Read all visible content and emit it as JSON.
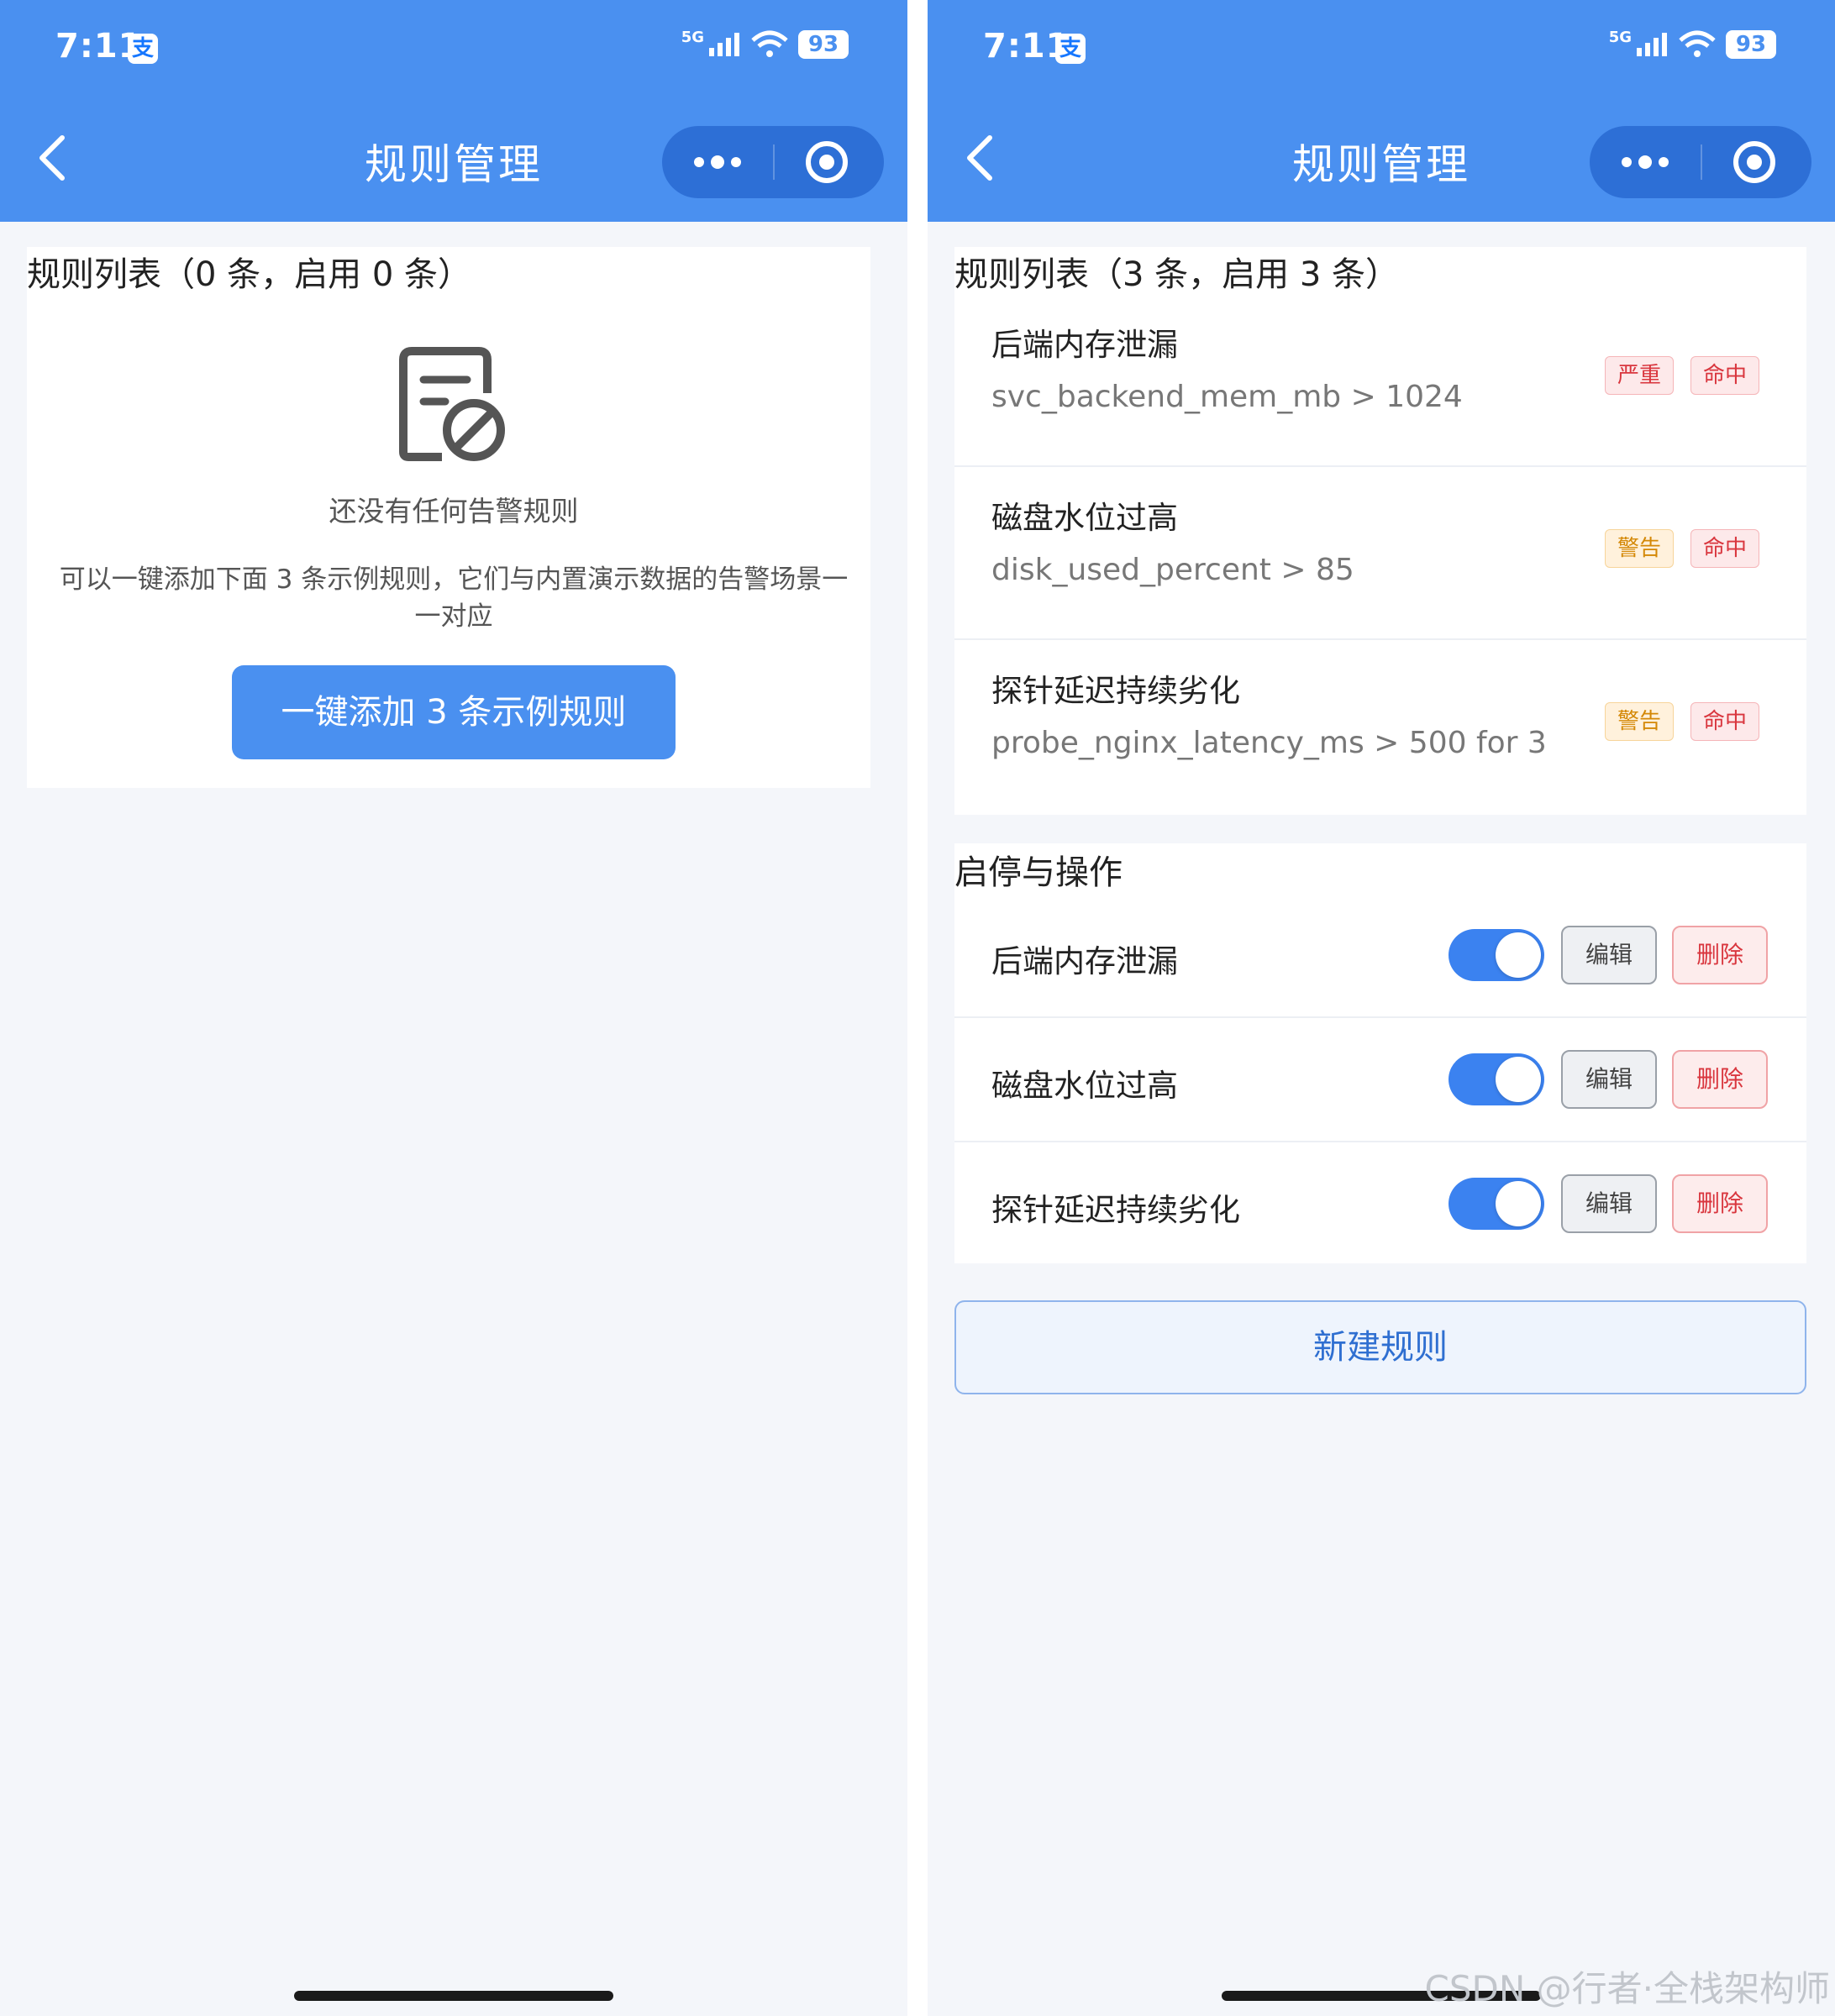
{
  "status_bar": {
    "time": "7:11",
    "alipay_badge": "支",
    "network": "5G",
    "battery": "93"
  },
  "nav": {
    "title": "规则管理"
  },
  "left": {
    "list_title": "规则列表（0 条，启用 0 条）",
    "empty_title": "还没有任何告警规则",
    "empty_desc": "可以一键添加下面 3 条示例规则，它们与内置演示数据的告警场景一一对应",
    "add_examples_button": "一键添加 3 条示例规则"
  },
  "right": {
    "list_title": "规则列表（3 条，启用 3 条）",
    "rules": [
      {
        "name": "后端内存泄漏",
        "expr": "svc_backend_mem_mb > 1024",
        "severity": "严重",
        "severity_level": "critical",
        "status": "命中"
      },
      {
        "name": "磁盘水位过高",
        "expr": "disk_used_percent > 85",
        "severity": "警告",
        "severity_level": "warning",
        "status": "命中"
      },
      {
        "name": "探针延迟持续劣化",
        "expr": "probe_nginx_latency_ms > 500 for 3",
        "severity": "警告",
        "severity_level": "warning",
        "status": "命中"
      }
    ],
    "ops_title": "启停与操作",
    "ops": [
      {
        "name": "后端内存泄漏",
        "enabled": true,
        "edit": "编辑",
        "delete": "删除"
      },
      {
        "name": "磁盘水位过高",
        "enabled": true,
        "edit": "编辑",
        "delete": "删除"
      },
      {
        "name": "探针延迟持续劣化",
        "enabled": true,
        "edit": "编辑",
        "delete": "删除"
      }
    ],
    "new_rule_button": "新建规则"
  },
  "watermark": "CSDN @行者·全栈架构师",
  "colors": {
    "primary": "#4a90f0",
    "danger": "#d9363e",
    "warning": "#d48806",
    "background": "#f4f6fa"
  },
  "icons": [
    "back-arrow-icon",
    "more-dots-icon",
    "close-target-icon",
    "signal-icon",
    "wifi-icon",
    "empty-doc-icon"
  ]
}
